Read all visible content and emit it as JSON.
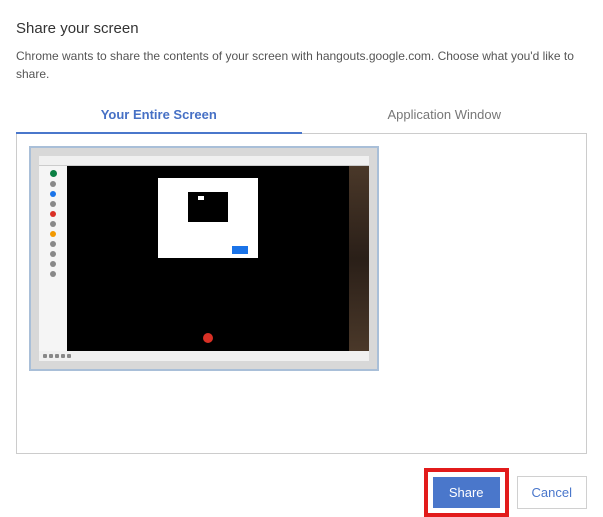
{
  "dialog": {
    "title": "Share your screen",
    "description": "Chrome wants to share the contents of your screen with hangouts.google.com. Choose what you'd like to share."
  },
  "tabs": {
    "entire_screen": "Your Entire Screen",
    "app_window": "Application Window"
  },
  "buttons": {
    "share": "Share",
    "cancel": "Cancel"
  }
}
